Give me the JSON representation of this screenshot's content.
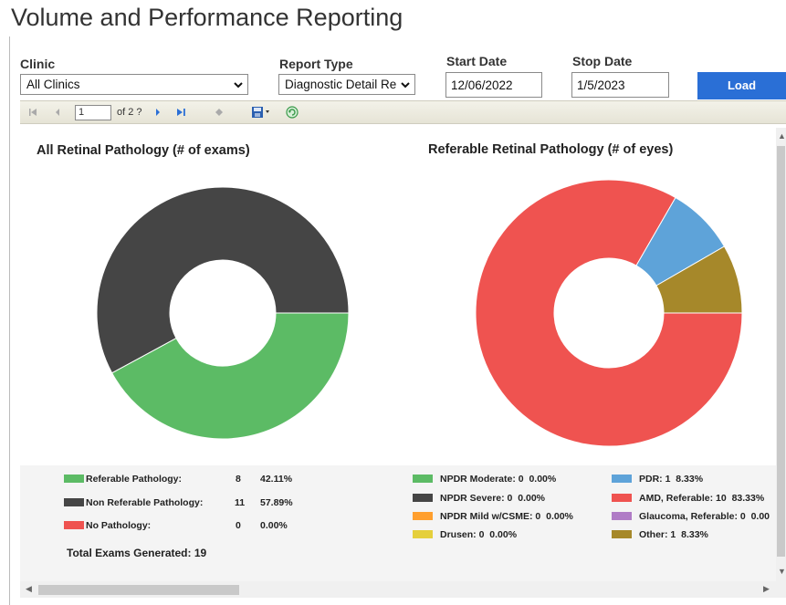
{
  "page": {
    "title": "Volume and Performance Reporting"
  },
  "filters": {
    "clinic_label": "Clinic",
    "clinic_value": "All Clinics",
    "report_type_label": "Report Type",
    "report_type_value": "Diagnostic Detail Re",
    "start_date_label": "Start Date",
    "start_date_value": "12/06/2022",
    "stop_date_label": "Stop Date",
    "stop_date_value": "1/5/2023",
    "load_label": "Load"
  },
  "toolbar": {
    "page_value": "1",
    "page_of": "of 2 ?"
  },
  "colors": {
    "green": "#5cbb65",
    "dark": "#454545",
    "red": "#ef5350",
    "blue": "#5ea3d9",
    "orange": "#ff9f2e",
    "yellow": "#e5cf3c",
    "purple": "#b07cc6",
    "olive": "#a6882a"
  },
  "chart_data": [
    {
      "type": "pie",
      "title": "All Retinal Pathology (# of exams)",
      "donut": true,
      "series": [
        {
          "name": "Referable Pathology:",
          "value": 8,
          "percent": "42.11%",
          "color": "#5cbb65"
        },
        {
          "name": "Non Referable Pathology:",
          "value": 11,
          "percent": "57.89%",
          "color": "#454545"
        },
        {
          "name": "No Pathology:",
          "value": 0,
          "percent": "0.00%",
          "color": "#ef5350"
        }
      ],
      "footer": "Total Exams Generated: 19"
    },
    {
      "type": "pie",
      "title": "Referable Retinal Pathology (# of eyes)",
      "donut": true,
      "series": [
        {
          "name": "NPDR Moderate:",
          "value": 0,
          "percent": "0.00%",
          "color": "#5cbb65"
        },
        {
          "name": "NPDR Severe:",
          "value": 0,
          "percent": "0.00%",
          "color": "#454545"
        },
        {
          "name": "NPDR Mild w/CSME:",
          "value": 0,
          "percent": "0.00%",
          "color": "#ff9f2e"
        },
        {
          "name": "Drusen:",
          "value": 0,
          "percent": "0.00%",
          "color": "#e5cf3c"
        },
        {
          "name": "PDR:",
          "value": 1,
          "percent": "8.33%",
          "color": "#5ea3d9"
        },
        {
          "name": "AMD, Referable:",
          "value": 10,
          "percent": "83.33%",
          "color": "#ef5350"
        },
        {
          "name": "Glaucoma, Referable:",
          "value": 0,
          "percent": "0.00",
          "color": "#b07cc6"
        },
        {
          "name": "Other:",
          "value": 1,
          "percent": "8.33%",
          "color": "#a6882a"
        }
      ]
    }
  ]
}
